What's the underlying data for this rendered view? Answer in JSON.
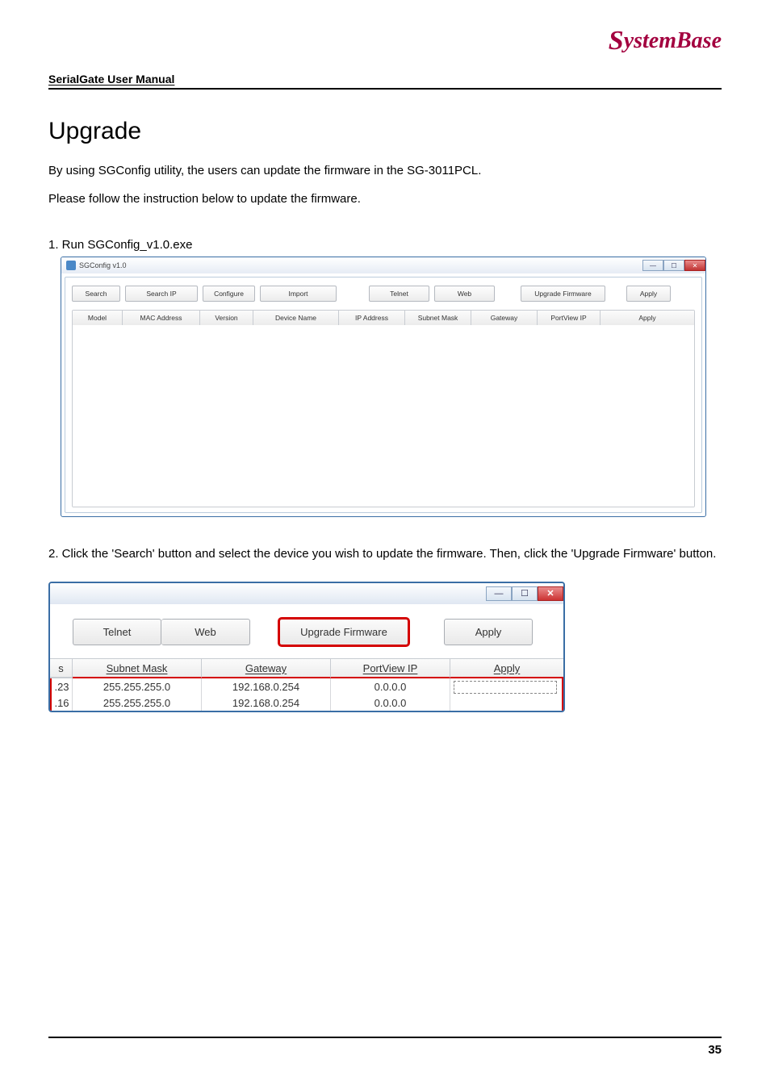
{
  "brand": {
    "text_prefix": "S",
    "text_rest": "ystemBase"
  },
  "header": {
    "manual_title": "SerialGate User Manual"
  },
  "section": {
    "title": "Upgrade"
  },
  "para": {
    "p1": "By using SGConfig utility, the users can update the firmware in the SG-3011PCL.",
    "p2": "Please follow the instruction below to update the firmware.",
    "step1": "1. Run SGConfig_v1.0.exe",
    "step2": "2. Click the 'Search' button and select the device you wish to update the firmware. Then, click the 'Upgrade Firmware' button."
  },
  "win1": {
    "title": "SGConfig v1.0",
    "buttons": {
      "search": "Search",
      "search_ip": "Search IP",
      "configure": "Configure",
      "import": "Import",
      "telnet": "Telnet",
      "web": "Web",
      "upgrade_firmware": "Upgrade Firmware",
      "apply": "Apply"
    },
    "columns": {
      "model": "Model",
      "mac": "MAC Address",
      "version": "Version",
      "device_name": "Device Name",
      "ip": "IP Address",
      "subnet": "Subnet Mask",
      "gateway": "Gateway",
      "portview": "PortView IP",
      "apply": "Apply"
    }
  },
  "win2": {
    "buttons": {
      "telnet": "Telnet",
      "web": "Web",
      "upgrade_firmware": "Upgrade Firmware",
      "apply": "Apply"
    },
    "columns": {
      "s": "s",
      "subnet": "Subnet Mask",
      "gateway": "Gateway",
      "portview": "PortView IP",
      "apply": "Apply"
    },
    "rows": [
      {
        "s": ".23",
        "subnet": "255.255.255.0",
        "gateway": "192.168.0.254",
        "portview": "0.0.0.0",
        "apply_dashed": true
      },
      {
        "s": ".16",
        "subnet": "255.255.255.0",
        "gateway": "192.168.0.254",
        "portview": "0.0.0.0",
        "apply_dashed": false
      }
    ]
  },
  "footer": {
    "page": "35"
  }
}
